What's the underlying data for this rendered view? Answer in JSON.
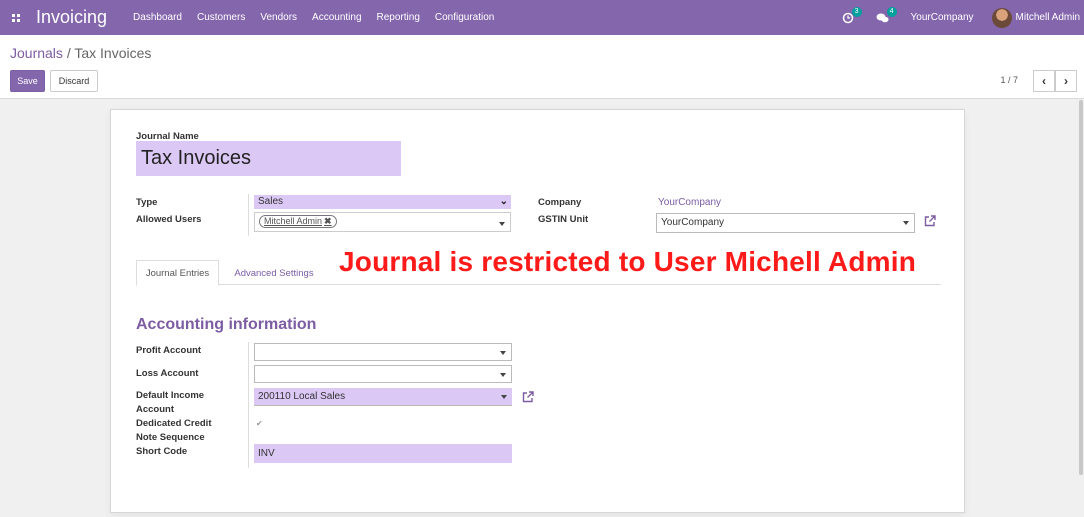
{
  "navbar": {
    "app_title": "Invoicing",
    "menu": [
      "Dashboard",
      "Customers",
      "Vendors",
      "Accounting",
      "Reporting",
      "Configuration"
    ],
    "activity_count": "3",
    "message_count": "4",
    "company": "YourCompany",
    "user": "Mitchell Admin"
  },
  "breadcrumb": {
    "parent": "Journals",
    "separator": "/",
    "current": "Tax Invoices"
  },
  "buttons": {
    "save": "Save",
    "discard": "Discard"
  },
  "pager": {
    "text": "1 / 7"
  },
  "form": {
    "journal_name_label": "Journal Name",
    "journal_name": "Tax Invoices",
    "type_label": "Type",
    "type_value": "Sales",
    "allowed_users_label": "Allowed Users",
    "allowed_users": [
      "Mitchell Admin"
    ],
    "company_label": "Company",
    "company_value": "YourCompany",
    "gstin_label": "GSTIN Unit",
    "gstin_value": "YourCompany"
  },
  "tabs": [
    "Journal Entries",
    "Advanced Settings"
  ],
  "annotation": "Journal is restricted to User Michell Admin",
  "accounting": {
    "title": "Accounting information",
    "profit_account_label": "Profit Account",
    "profit_account": "",
    "loss_account_label": "Loss Account",
    "loss_account": "",
    "default_income_label_1": "Default Income",
    "default_income_label_2": "Account",
    "default_income": "200110 Local Sales",
    "dedicated_credit_label_1": "Dedicated Credit",
    "dedicated_credit_label_2": "Note Sequence",
    "dedicated_credit_checked": true,
    "short_code_label": "Short Code",
    "short_code": "INV"
  },
  "colors": {
    "brand": "#8466ad",
    "field_highlight": "#dcc8f5",
    "annotation": "#ff1a1a"
  }
}
